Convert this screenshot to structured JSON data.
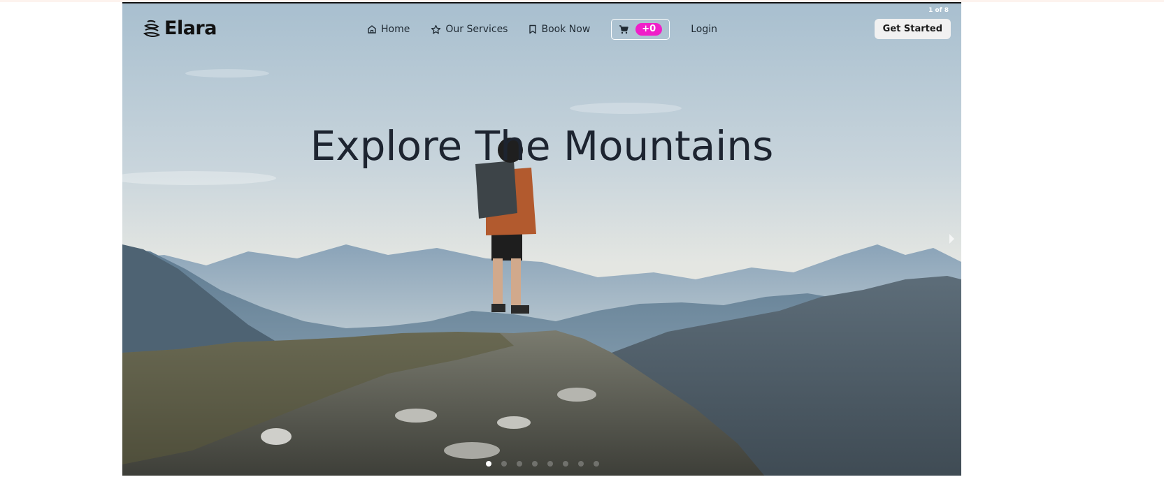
{
  "brand": {
    "name": "Elara"
  },
  "nav": {
    "home": "Home",
    "services": "Our Services",
    "book": "Book Now",
    "cart_count": "+0",
    "login": "Login",
    "get_started": "Get Started"
  },
  "carousel": {
    "counter": "1 of 8",
    "title": "Explore The Mountains",
    "total_slides": 8,
    "active_slide": 1
  },
  "colors": {
    "accent_badge": "#f01fc9",
    "title_text": "#1d2430"
  },
  "icons": {
    "home": "home-icon",
    "services": "star-icon",
    "book": "bookmark-icon",
    "cart": "cart-icon",
    "logo": "elara-logo-icon",
    "next": "chevron-right-icon"
  }
}
